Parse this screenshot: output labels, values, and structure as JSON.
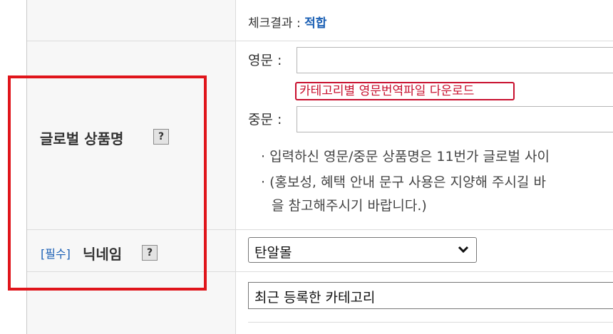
{
  "check": {
    "label": "체크결과 : ",
    "result": "적합"
  },
  "global_name": {
    "label": "글로벌 상품명",
    "help": "?",
    "english_label": "영문 :",
    "english_value": "",
    "download_button": "카테고리별 영문번역파일 다운로드",
    "chinese_label": "중문 :",
    "chinese_value": "",
    "notices": [
      "· 입력하신 영문/중문 상품명은 11번가 글로벌 사이",
      "· (홍보성, 혜택 안내 문구 사용은 지양해 주시길 바",
      "을 참고해주시기 바랍니다.)"
    ]
  },
  "nickname": {
    "required": "[필수]",
    "label": "닉네임",
    "help": "?",
    "selected": "탄알몰"
  },
  "category": {
    "value": "최근 등록한 카테고리"
  },
  "colors": {
    "highlight": "#e0151b",
    "accent": "#1a5fb4",
    "download": "#c8102e"
  }
}
